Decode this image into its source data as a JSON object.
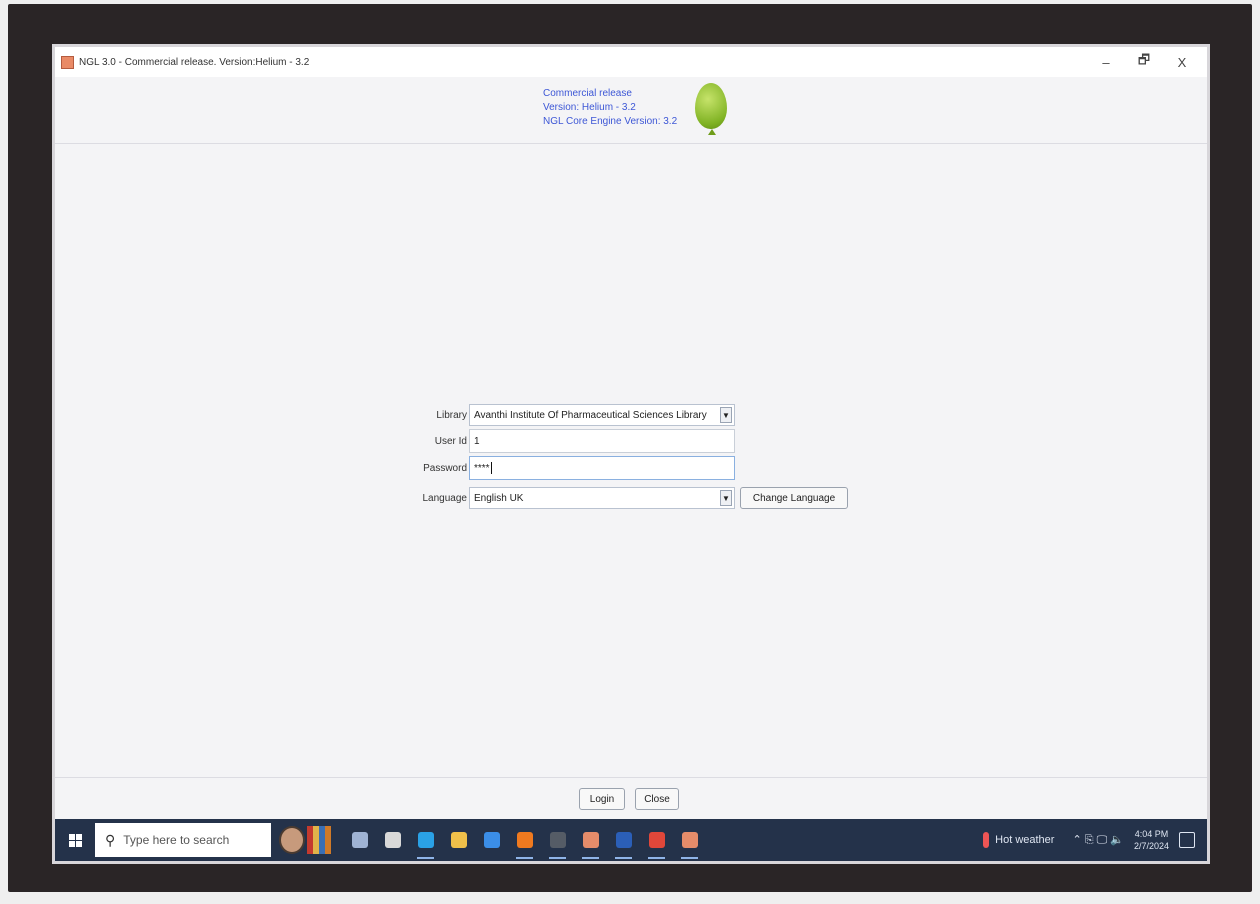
{
  "window": {
    "title": "NGL 3.0 - Commercial release. Version:Helium - 3.2",
    "controls": {
      "minimize": "–",
      "maximize": "🗗",
      "close": "X"
    }
  },
  "header": {
    "line1": "Commercial release",
    "line2": "Version: Helium - 3.2",
    "line3": "NGL Core Engine Version: 3.2",
    "logo_icon": "green-balloon-icon"
  },
  "form": {
    "library_label": "Library",
    "library_value": "Avanthi Institute Of Pharmaceutical Sciences Library",
    "userid_label": "User Id",
    "userid_value": "1",
    "password_label": "Password",
    "password_value": "****",
    "language_label": "Language",
    "language_value": "English UK",
    "change_language_label": "Change Language",
    "dropdown_arrow": "▼"
  },
  "footer": {
    "login_label": "Login",
    "close_label": "Close"
  },
  "taskbar": {
    "search_placeholder": "Type here to search",
    "search_icon": "⚲",
    "weather_text": "Hot weather",
    "tray_glyphs": "⌃ ⎘ 🖵 🔈",
    "time": "4:04 PM",
    "date": "2/7/2024",
    "apps": [
      {
        "name": "task-view-icon",
        "color": "#9fb3d4"
      },
      {
        "name": "store-icon",
        "color": "#d9d9d9"
      },
      {
        "name": "edge-icon",
        "color": "#2aa1e6"
      },
      {
        "name": "file-explorer-icon",
        "color": "#f0c04a"
      },
      {
        "name": "mail-icon",
        "color": "#3b8ee8"
      },
      {
        "name": "firefox-icon",
        "color": "#f07a1f"
      },
      {
        "name": "terminal-icon",
        "color": "#555c66"
      },
      {
        "name": "java-app-icon",
        "color": "#e58c6a"
      },
      {
        "name": "word-icon",
        "color": "#2b5fb8"
      },
      {
        "name": "chrome-icon",
        "color": "#e0473a"
      },
      {
        "name": "java-app-active-icon",
        "color": "#e58c6a"
      }
    ]
  }
}
